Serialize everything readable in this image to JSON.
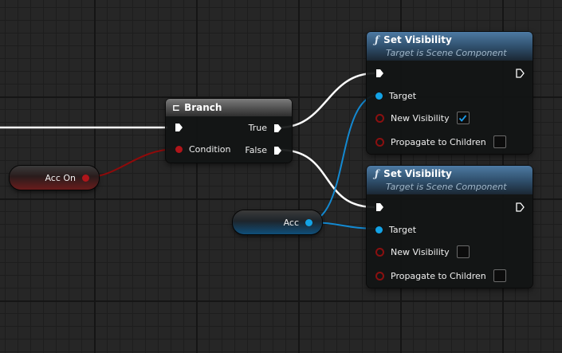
{
  "colors": {
    "exec_wire": "#ffffff",
    "bool_wire": "#8f0a0a",
    "object_wire": "#1389d1"
  },
  "branch_node": {
    "title": "Branch",
    "icon": "branch-icon",
    "pins": {
      "condition": "Condition",
      "true": "True",
      "false": "False"
    }
  },
  "set_visibility_nodes": [
    {
      "title": "Set Visibility",
      "subtitle": "Target is Scene Component",
      "icon": "function-icon",
      "pins": {
        "target": "Target",
        "new_visibility": "New Visibility",
        "propagate": "Propagate to Children"
      },
      "new_visibility_checked": true,
      "propagate_checked": false
    },
    {
      "title": "Set Visibility",
      "subtitle": "Target is Scene Component",
      "icon": "function-icon",
      "pins": {
        "target": "Target",
        "new_visibility": "New Visibility",
        "propagate": "Propagate to Children"
      },
      "new_visibility_checked": false,
      "propagate_checked": false
    }
  ],
  "variables": {
    "acc_on": {
      "label": "Acc On",
      "type": "boolean"
    },
    "acc": {
      "label": "Acc",
      "type": "object"
    }
  }
}
